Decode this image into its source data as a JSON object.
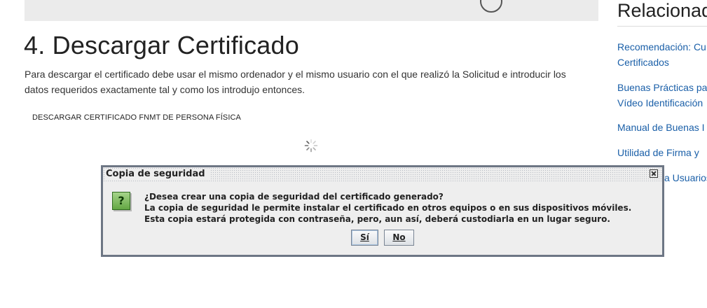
{
  "main": {
    "title": "4. Descargar Certificado",
    "paragraph_line1": "Para descargar el certificado debe usar el mismo ordenador y el mismo usuario con el que realizó la Solicitud e introducir los",
    "paragraph_line2": "datos requeridos exactamente tal y como los introdujo entonces.",
    "download_link": "DESCARGAR CERTIFICADO FNMT DE PERSONA FÍSICA",
    "loading_icon": "spinner-icon"
  },
  "sidebar": {
    "title": "Relacionad",
    "links": [
      {
        "line1": "Recomendación: Cu",
        "line2": "Certificados"
      },
      {
        "line1": "Buenas Prácticas pa",
        "line2": "Vídeo Identificación"
      },
      {
        "line1": "Manual de Buenas I"
      },
      {
        "line1": "Utilidad de Firma y"
      },
      {
        "line1": "a Usuarios"
      }
    ]
  },
  "dialog": {
    "title": "Copia de seguridad",
    "icon": "question-icon",
    "icon_glyph": "?",
    "message": [
      "¿Desea crear una copia de seguridad del certificado generado?",
      "La copia de seguridad le permite instalar el certificado en otros equipos o en sus dispositivos móviles.",
      "Esta copia estará protegida con contraseña, pero, aun así, deberá custodiarla en un lugar seguro."
    ],
    "yes_label": "Sí",
    "no_label": "No"
  },
  "colors": {
    "link": "#1a5fa8",
    "dialog_border": "#6d7684",
    "dialog_bg": "#eeeeee",
    "icon_green": "#63a744"
  }
}
